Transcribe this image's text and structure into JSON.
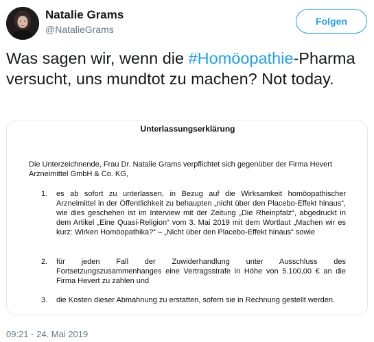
{
  "author": {
    "name": "Natalie Grams",
    "handle": "@NatalieGrams",
    "avatar_icon": "profile-photo"
  },
  "follow_button": {
    "label": "Folgen"
  },
  "tweet": {
    "text_before": "Was sagen wir, wenn die ",
    "hashtag": "#Homöopathie",
    "text_after": "-Pharma versucht, uns mundtot zu machen? Not today."
  },
  "document": {
    "title": "Unterlassungserklärung",
    "intro": "Die Unterzeichnende, Frau Dr. Natalie Grams verpflichtet sich gegenüber der Firma Hevert Arzneimittel GmbH & Co. KG,",
    "items": [
      {
        "num": "1.",
        "text": "es ab sofort zu unterlassen, in Bezug auf die Wirksamkeit homöopathischer Arzneimittel in der Öffentlichkeit zu behaupten „nicht über den Placebo-Effekt hinaus“, wie dies geschehen ist im Interview mit der Zeitung „Die Rheinpfalz“, abgedruckt in dem Artikel „Eine Quasi-Religion“ vom 3. Mai 2019 mit dem Wortlaut „Machen wir es kurz: Wirken Homöopathika?“ – „Nicht über den Placebo-Effekt hinaus“ sowie"
      },
      {
        "num": "2.",
        "text": "für jeden Fall der Zuwiderhandlung unter Ausschluss des Fortsetzungszusammenhanges eine Vertragsstrafe in Höhe von 5.100,00 € an die Firma Hevert zu zahlen und"
      },
      {
        "num": "3.",
        "text": "die Kosten dieser Abmahnung zu erstatten, sofern sie in Rechnung gestellt werden."
      }
    ]
  },
  "timestamp": "09:21 - 24. Mai 2019",
  "colors": {
    "accent": "#1da1f2",
    "secondary_text": "#657786",
    "primary_text": "#14171a"
  }
}
